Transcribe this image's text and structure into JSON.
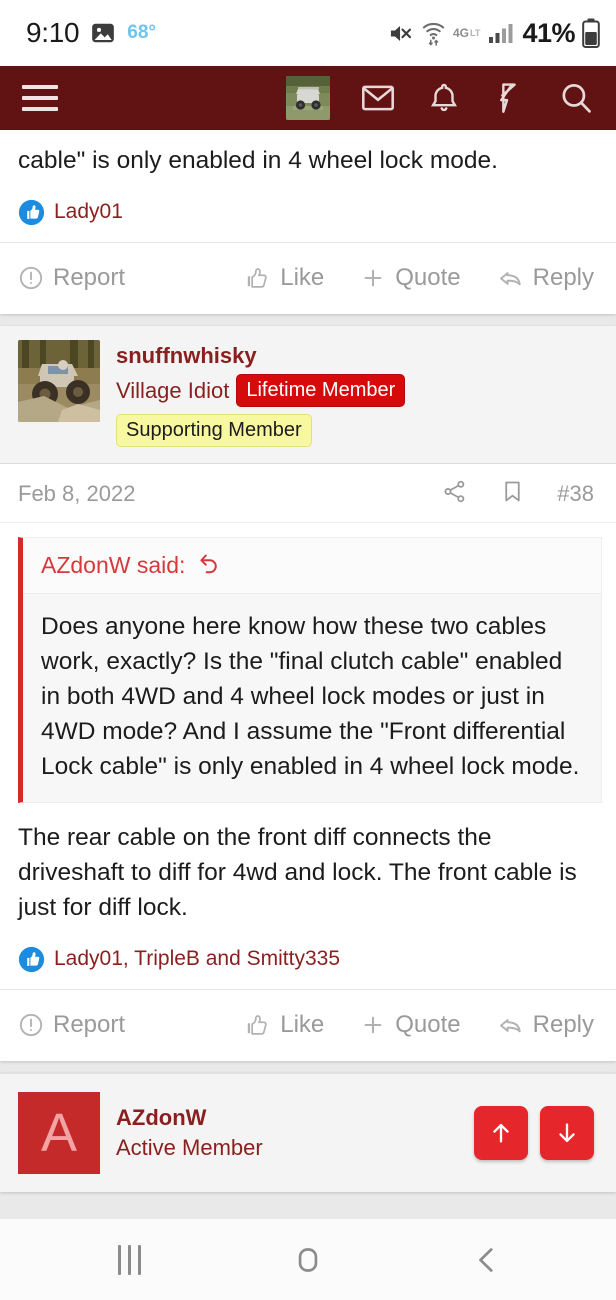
{
  "status_bar": {
    "time": "9:10",
    "temperature": "68°",
    "battery_percent": "41%",
    "network": "4G",
    "icons": [
      "photo-icon",
      "mute-icon",
      "wifi-icon",
      "lte-icon",
      "signal-icon",
      "battery-icon"
    ]
  },
  "app_bar": {
    "brand_color": "#611313",
    "menu_icon": "hamburger-menu-icon",
    "avatar_alt": "user-avatar-utv-photo",
    "icons": [
      "inbox-icon",
      "bell-icon",
      "lightning-icon",
      "search-icon"
    ]
  },
  "post_top": {
    "text": "cable\" is only enabled in 4 wheel lock mode.",
    "reactions": {
      "icon": "thumbs-up-reaction-icon",
      "names": "Lady01"
    },
    "actions": {
      "report": "Report",
      "like": "Like",
      "quote": "Quote",
      "reply": "Reply"
    }
  },
  "post_main": {
    "author": "snuffnwhisky",
    "user_title": "Village Idiot",
    "badges": [
      {
        "label": "Lifetime Member",
        "bg": "#d60a0a",
        "fg": "#ffffff"
      },
      {
        "label": "Supporting Member",
        "bg": "#f8f8a0",
        "fg": "#1c1c1c"
      }
    ],
    "date": "Feb 8, 2022",
    "post_number": "#38",
    "meta_icons": [
      "share-icon",
      "bookmark-icon"
    ],
    "quote": {
      "attribution": "AZdonW said:",
      "jump_icon": "reply-back-arrow-icon",
      "text": "Does anyone here know how these two cables work, exactly? Is the \"final clutch cable\" enabled in both 4WD and 4 wheel lock modes or just in 4WD mode? And I assume the \"Front differential Lock cable\" is only enabled in 4 wheel lock mode."
    },
    "body": "The rear cable on the front diff connects the driveshaft to diff for 4wd and lock. The front cable is just for diff lock.",
    "reactions": {
      "icon": "thumbs-up-reaction-icon",
      "names": "Lady01, TripleB and Smitty335"
    },
    "actions": {
      "report": "Report",
      "like": "Like",
      "quote": "Quote",
      "reply": "Reply"
    }
  },
  "post_next": {
    "avatar_letter": "A",
    "avatar_bg": "#c42a2a",
    "author": "AZdonW",
    "user_title": "Active Member",
    "scroll_buttons": [
      {
        "name": "scroll-up-button",
        "icon": "arrow-up-icon"
      },
      {
        "name": "scroll-down-button",
        "icon": "arrow-down-icon"
      }
    ],
    "button_color": "#e5262a"
  },
  "nav_bar": {
    "recents": "recents-icon",
    "home": "home-icon",
    "back": "back-icon"
  }
}
